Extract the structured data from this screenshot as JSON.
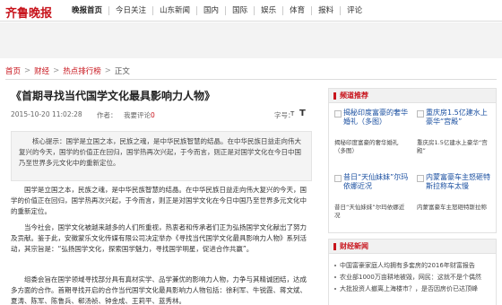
{
  "site": {
    "logo_text": "齐鲁晚报"
  },
  "nav": {
    "items": [
      {
        "label": "晚报首页",
        "active": true
      },
      {
        "label": "今日关注"
      },
      {
        "label": "山东新闻"
      },
      {
        "label": "国内"
      },
      {
        "label": "国际"
      },
      {
        "label": "娱乐"
      },
      {
        "label": "体育"
      },
      {
        "label": "报料"
      },
      {
        "label": "评论"
      }
    ]
  },
  "breadcrumb": {
    "items": [
      "首页",
      "财经",
      "热点排行榜",
      "正文"
    ],
    "separator": ">"
  },
  "article": {
    "title": "《首期寻找当代国学文化最具影响力人物》",
    "time": "2015-10-20 11:02:28",
    "author_label": "作者：",
    "comment_label": "我要评论",
    "comment_count": "0",
    "font_label": "字号：",
    "font_small": "T",
    "font_large": "T",
    "summary": "核心提示：国学是立国之本，民族之魂，是中华民族智慧的结晶。在中华民族日益走向伟大复兴的今天，国学的价值正在回归，国学热再次兴起，于今而言，则正是对国学文化在今日中国乃至世界多元文化中的重新定位。",
    "paragraphs": [
      "国学是立国之本，民族之魂，是中华民族智慧的结晶。在中华民族日益走向伟大复兴的今天，国学的价值正在回归，国学热再次兴起，于今而言，则正是对国学文化在今日中国乃至世界多元文化中的重新定位。",
      "当今社会，国学文化被越来越多的人们所重视，热衷者和传承者们正为弘扬国学文化献出了努力及贡献。鉴于此，安徽蒙乐文化传媒有限公司决定举办《寻找当代国学文化最具影响力人物》系列活动，其宗旨是：“弘扬国学文化，探索国学魅力，寻找国学明星，促进合作共赢”。",
      "组委会旨在国学领域寻找部分具有真材实学、品学兼优的影响力人物，力争与其精诚团结，达成多方面的合作。首期寻找开启的合作当代国学文化最具影响力人物包括：徐利军、牛锐霞、蒋文斌、夏涛、陈军、陈鲁兵、郗汤祯、钟金成、王莉平、蓝秀林。"
    ]
  },
  "sidebar": {
    "recommend": {
      "title": "频道推荐",
      "items": [
        {
          "title": "揭秘印度富豪的奢华婚礼（多图）",
          "desc": "揭秘印度富豪的奢华婚礼（多图）"
        },
        {
          "title": "重庆房1.5亿建水上豪华“宫殿”",
          "desc": "重庆房1.5亿建水上豪华“宫殿”"
        },
        {
          "title": "昔日“天仙妹妹”尔玛依娜近况",
          "desc": "昔日“天仙妹妹”尔玛依娜近况"
        },
        {
          "title": "内蒙富豪车主怒砸特斯拉称车太慢",
          "desc": "内蒙富豪车主怒砸特斯拉称"
        }
      ]
    },
    "news": {
      "title": "财经新闻",
      "items": [
        "中国富豪家庭人均拥有多套房的2016年财富报告",
        "农业部1000万亩耕地被毁，网民：这就不是个偶然",
        "大批投资人撤离上海楼市？，是否因房价已达顶峰"
      ]
    }
  }
}
